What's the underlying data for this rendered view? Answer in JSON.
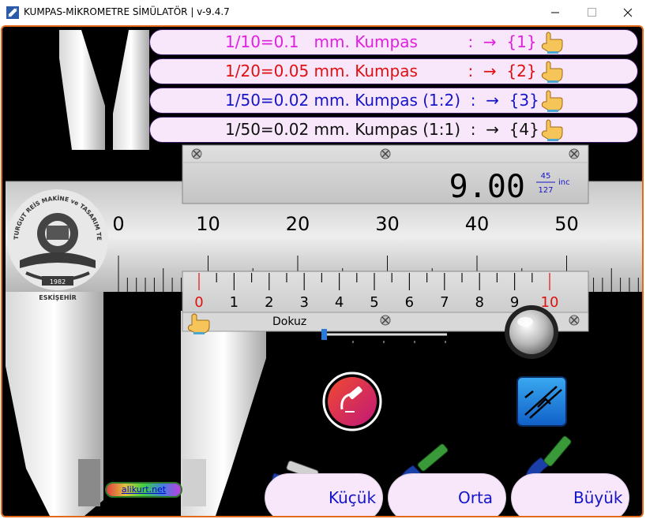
{
  "window": {
    "title": "KUMPAS-MİKROMETRE SİMÜLATÖR  |  v-9.4.7"
  },
  "menu": {
    "items": [
      {
        "label": "1/10=0.1   mm. Kumpas          :  →  {1}",
        "color": "#e020e0"
      },
      {
        "label": "1/20=0.05 mm. Kumpas          :  →  {2}",
        "color": "#e01010"
      },
      {
        "label": "1/50=0.02 mm. Kumpas (1:2)  :  →  {3}",
        "color": "#1515c8"
      },
      {
        "label": "1/50=0.02 mm. Kumpas (1:1)  :  →  {4}",
        "color": "#111111"
      }
    ]
  },
  "readout": {
    "value": "9.00",
    "inch_numerator": "45",
    "inch_denominator": "127",
    "inch_unit": "inc"
  },
  "main_scale": {
    "labels": [
      "0",
      "10",
      "20",
      "30",
      "40",
      "50"
    ]
  },
  "vernier_scale": {
    "labels": [
      "0",
      "1",
      "2",
      "3",
      "4",
      "5",
      "6",
      "7",
      "8",
      "9",
      "10"
    ],
    "highlight_color": "#e01010",
    "status_text": "Dokuz"
  },
  "logo": {
    "arc_text": "TURGUT REİS MAKİNE ve TASARIM TEKNOLOJİSİ ALANI",
    "year": "1982",
    "city": "ESKİŞEHİR"
  },
  "buttons": {
    "small_label": "Küçük",
    "medium_label": "Orta",
    "large_label": "Büyük"
  },
  "link": {
    "text": "alikurt.net"
  },
  "slider": {
    "value_fraction": 0.0
  },
  "colors": {
    "frame_border": "#e36a1a",
    "menu_bg": "#f8e6fa",
    "menu_border": "#3b1c63",
    "button_text": "#1515c8"
  },
  "icons": {
    "app": "caliper-app-icon",
    "hand": "pointing-hand-icon",
    "screw": "screw-icon",
    "knob": "thumbwheel-knob-icon",
    "micrometer_round": "micrometer-round-icon",
    "caliper_square": "caliper-square-icon",
    "micrometer_small": "micrometer-small-icon",
    "micrometer_medium": "micrometer-medium-icon",
    "micrometer_large": "micrometer-large-icon"
  }
}
